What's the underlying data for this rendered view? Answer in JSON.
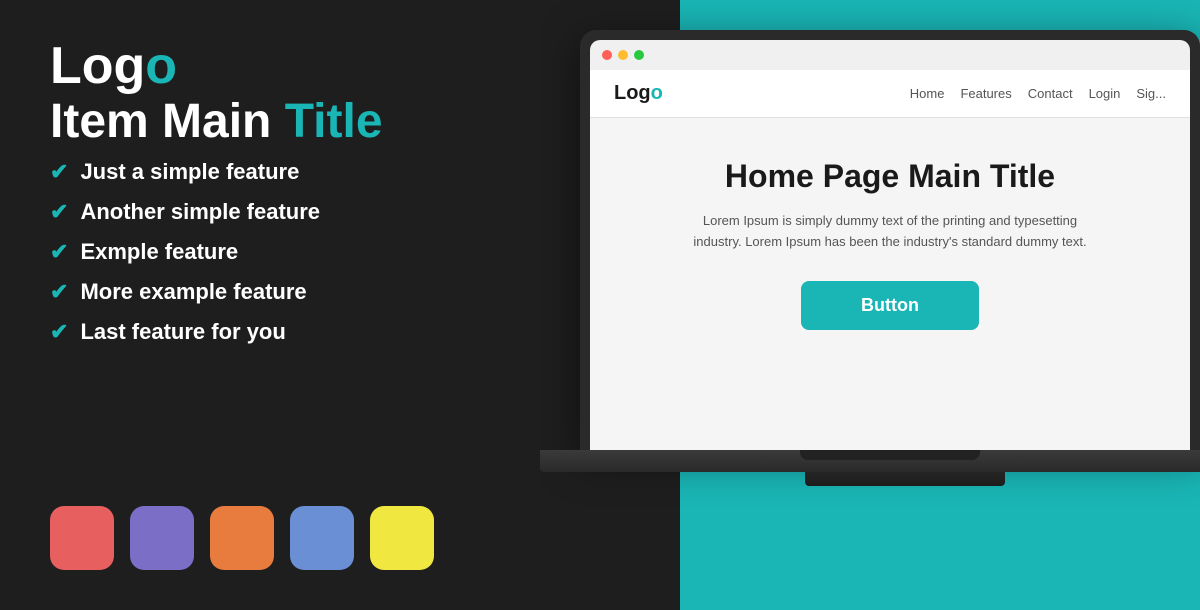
{
  "left": {
    "logo": {
      "text_plain": "Log",
      "text_accent": "o"
    },
    "title": {
      "plain": "Item Main ",
      "accent": "Title"
    },
    "features": [
      "Just a simple feature",
      "Another simple feature",
      "Exmple feature",
      "More example feature",
      "Last feature for you"
    ],
    "swatches": [
      {
        "color": "#e85f5f",
        "label": "red-swatch"
      },
      {
        "color": "#7b6ec6",
        "label": "purple-swatch"
      },
      {
        "color": "#e87c3e",
        "label": "orange-swatch"
      },
      {
        "color": "#6b8fd4",
        "label": "blue-swatch"
      },
      {
        "color": "#f0e840",
        "label": "yellow-swatch"
      }
    ]
  },
  "website": {
    "logo_plain": "Log",
    "logo_accent": "o",
    "nav_links": [
      "Home",
      "Features",
      "Contact",
      "Login",
      "Sig..."
    ],
    "heading": "Home Page Main Title",
    "paragraph": "Lorem Ipsum is simply dummy text of the printing and typesetting industry. Lorem Ipsum has been the industry's standard dummy text.",
    "button_label": "Button"
  },
  "check_symbol": "✔"
}
